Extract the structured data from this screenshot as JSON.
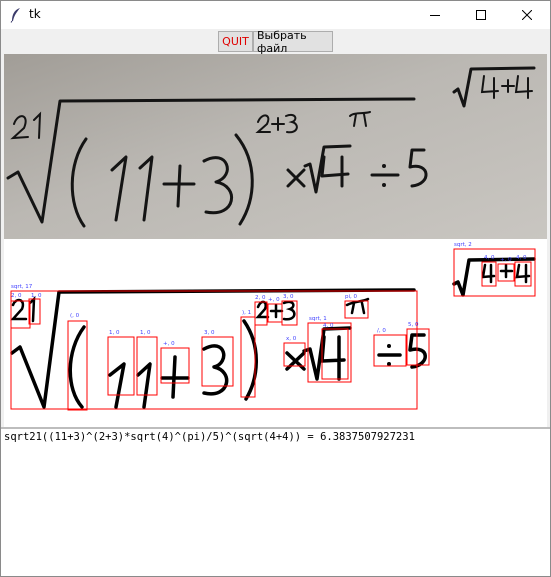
{
  "window": {
    "title": "tk",
    "controls": {
      "minimize": "minimize",
      "maximize": "maximize",
      "close": "close"
    }
  },
  "toolbar": {
    "quit_label": "QUIT",
    "choose_file_label": "Выбрать файл",
    "quit_color": "#e00000"
  },
  "photo": {
    "kind": "photo of handwritten expression",
    "symbols": {
      "root_index": "21",
      "open_paren": "(",
      "n11": "11",
      "plus": "+",
      "n3": "3",
      "close_paren": ")",
      "exponent": "2+3",
      "times": "×",
      "radicand": "4",
      "power": "π",
      "divide": "÷",
      "n5": "5",
      "outer_radicand": "4+4"
    }
  },
  "detections": {
    "box_color": "#ff0000",
    "label_color": "#4040ff",
    "labels": {
      "sqrt_outer": "sqrt, 2",
      "four_a": "4, 0",
      "plus_a": "+, 0",
      "four_b": "4, 0",
      "sqrt_main": "sqrt, 17",
      "two_a": "2, 0",
      "one_a": "1, 0",
      "two_b": "2, 0",
      "plus_b": "+, 0",
      "three_a": "3, 0",
      "pi": "pi, 0",
      "paren_open": "(, 0",
      "one_b": "1, 0",
      "one_c": "1, 0",
      "plus_c": "+, 0",
      "three_b": "3, 0",
      "paren_close": "), 1",
      "sqrt_inner": "sqrt, 1",
      "four_c": "4, 0",
      "times": "x, 0",
      "divide": "/, 0",
      "five": "5, 0"
    }
  },
  "output": {
    "expression": "sqrt21((11+3)^(2+3)*sqrt(4)^(pi)/5)^(sqrt(4+4)) = 6.3837507927231"
  }
}
